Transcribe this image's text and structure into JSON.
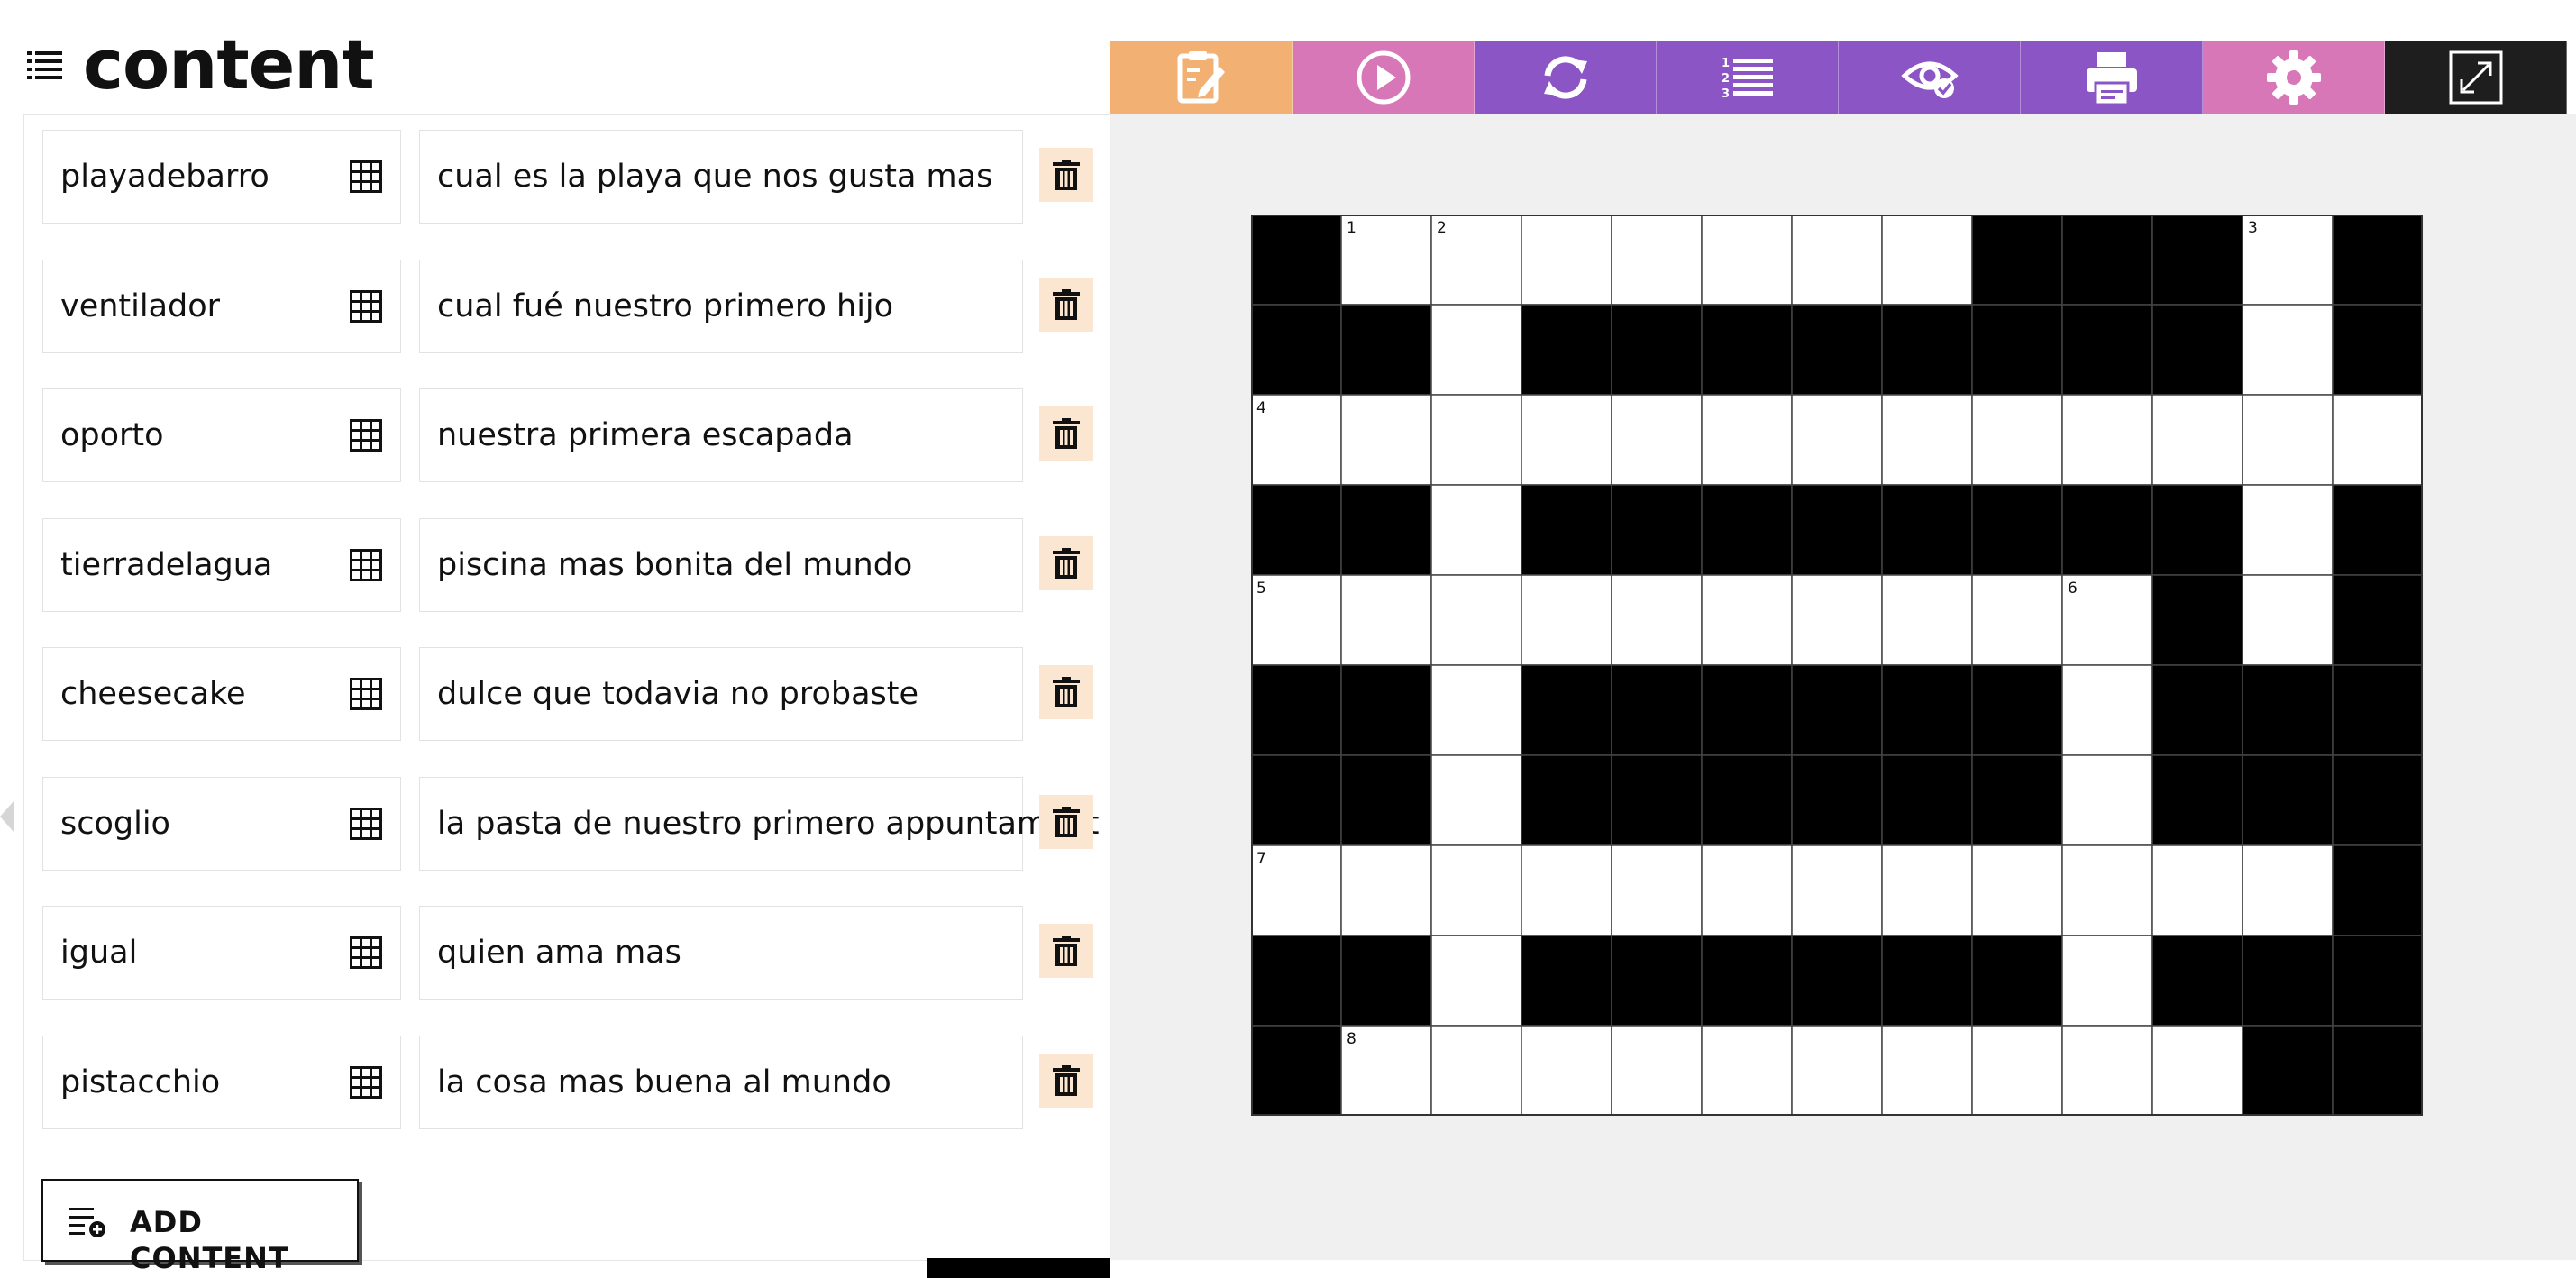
{
  "header": {
    "title": "content",
    "icon": "list-icon"
  },
  "entries": [
    {
      "answer": "playadebarro",
      "clue": "cual es la playa que nos gusta mas"
    },
    {
      "answer": "ventilador",
      "clue": "cual fué nuestro primero hijo"
    },
    {
      "answer": "oporto",
      "clue": "nuestra primera escapada"
    },
    {
      "answer": "tierradelagua",
      "clue": "piscina mas bonita del mundo"
    },
    {
      "answer": "cheesecake",
      "clue": "dulce que todavia no probaste"
    },
    {
      "answer": "scoglio",
      "clue": "la pasta de nuestro primero appuntament"
    },
    {
      "answer": "igual",
      "clue": "quien ama mas"
    },
    {
      "answer": "pistacchio",
      "clue": "la cosa mas buena al mundo"
    }
  ],
  "add_button": {
    "label": "ADD CONTENT"
  },
  "toolbar": [
    {
      "name": "edit-clipboard-icon",
      "color": "#f2b173"
    },
    {
      "name": "play-icon",
      "color": "#d877b8"
    },
    {
      "name": "refresh-icon",
      "color": "#8c55c5"
    },
    {
      "name": "numbered-list-icon",
      "color": "#8c55c5"
    },
    {
      "name": "preview-eye-icon",
      "color": "#8c55c5"
    },
    {
      "name": "print-icon",
      "color": "#8c55c5"
    },
    {
      "name": "settings-gear-icon",
      "color": "#d877b8"
    },
    {
      "name": "fullscreen-icon",
      "color": "#1e1e1e"
    }
  ],
  "crossword": {
    "rows": 10,
    "cols": 13,
    "grid": [
      "#.......###.#",
      "##.########.#",
      ".............",
      "##.########.#",
      "..........#.#",
      "##.######.###",
      "##.######.###",
      "............#",
      "##.######.###",
      "#..........##"
    ],
    "numbers": [
      {
        "row": 0,
        "col": 1,
        "n": "1"
      },
      {
        "row": 0,
        "col": 2,
        "n": "2"
      },
      {
        "row": 0,
        "col": 11,
        "n": "3"
      },
      {
        "row": 2,
        "col": 0,
        "n": "4"
      },
      {
        "row": 4,
        "col": 0,
        "n": "5"
      },
      {
        "row": 4,
        "col": 9,
        "n": "6"
      },
      {
        "row": 7,
        "col": 0,
        "n": "7"
      },
      {
        "row": 9,
        "col": 1,
        "n": "8"
      }
    ]
  }
}
